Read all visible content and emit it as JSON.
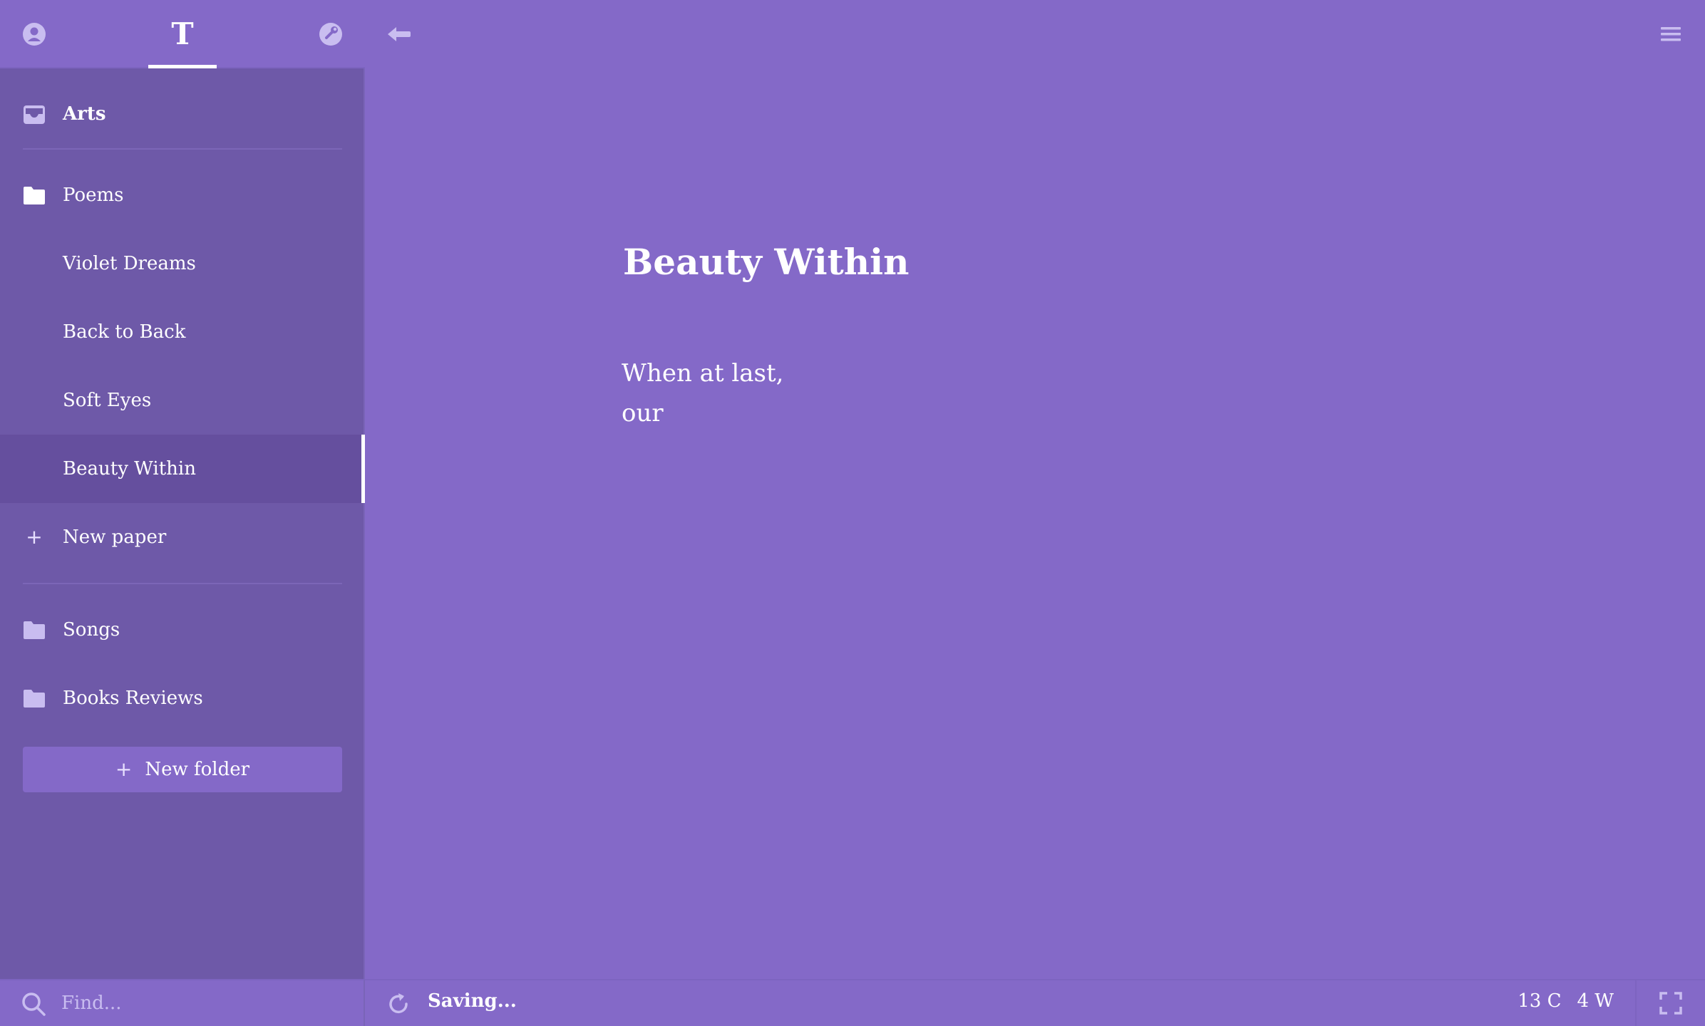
{
  "sidebar": {
    "tabs": [
      {
        "name": "profile",
        "icon": "user-circle-icon"
      },
      {
        "name": "texts",
        "glyph": "T",
        "icon": "text-icon"
      },
      {
        "name": "settings",
        "icon": "settings-icon"
      }
    ],
    "items": [
      {
        "type": "library",
        "label": "Arts",
        "icon": "tray-icon"
      },
      {
        "type": "folder",
        "label": "Poems",
        "icon": "folder-icon"
      },
      {
        "type": "paper",
        "label": "Violet Dreams"
      },
      {
        "type": "paper",
        "label": "Back to Back"
      },
      {
        "type": "paper",
        "label": "Soft Eyes"
      },
      {
        "type": "paper",
        "label": "Beauty Within",
        "active": true
      },
      {
        "type": "action",
        "label": "New paper",
        "icon": "plus-icon"
      },
      {
        "type": "folder",
        "label": "Songs",
        "icon": "folder-icon"
      },
      {
        "type": "folder",
        "label": "Books Reviews",
        "icon": "folder-icon"
      }
    ],
    "new_folder_plus": "+",
    "new_paper_plus": "+",
    "new_folder_label": "New folder",
    "search_placeholder": "Find..."
  },
  "editor": {
    "title": "Beauty Within",
    "body_lines": [
      "When at last,",
      "our"
    ]
  },
  "statusbar": {
    "status": "Saving...",
    "char_count": "13 C",
    "word_count": "4 W"
  },
  "colors": {
    "background": "#8469c8",
    "sidebar": "#6e59a8",
    "active_item": "#654f9e",
    "text": "#ffffff"
  }
}
